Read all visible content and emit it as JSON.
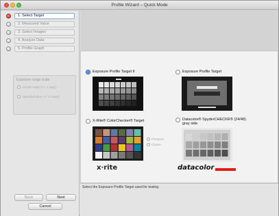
{
  "window": {
    "title": "Profile Wizard – Quick Mode"
  },
  "steps": [
    {
      "label": "1. Select Target",
      "active": true
    },
    {
      "label": "2. Measured Value",
      "active": false
    },
    {
      "label": "3. Select Images",
      "active": false
    },
    {
      "label": "4. Analyze Data",
      "active": false
    },
    {
      "label": "5. Profile Graph",
      "active": false
    }
  ],
  "exposure_range": {
    "title": "Exposure range scale",
    "options": [
      "Known value (+/- 1 stop)",
      "Standard Bins (+/- 6 stops)"
    ]
  },
  "buttons": {
    "back": "Back",
    "next": "Next",
    "cancel": "Cancel"
  },
  "targets": [
    {
      "label": "Exposure Profile Target II",
      "selected": true
    },
    {
      "label": "Exposure Profile Target",
      "selected": false
    },
    {
      "label": "X-Rite® ColorChecker® Target",
      "selected": false
    },
    {
      "label": "Datacolor® SpyderCHECKR® (24/48) gray side",
      "selected": false
    }
  ],
  "colorchecker_options": [
    "Passport",
    "Classic"
  ],
  "brands": {
    "xrite": "x·rite",
    "datacolor": "datacolor"
  },
  "caption": "Select the Exposure Profile Target used for testing.",
  "colors": {
    "accent": "#2b5aa5",
    "active_bullet": "#d9261a",
    "datacolor_red": "#e21b1b"
  }
}
